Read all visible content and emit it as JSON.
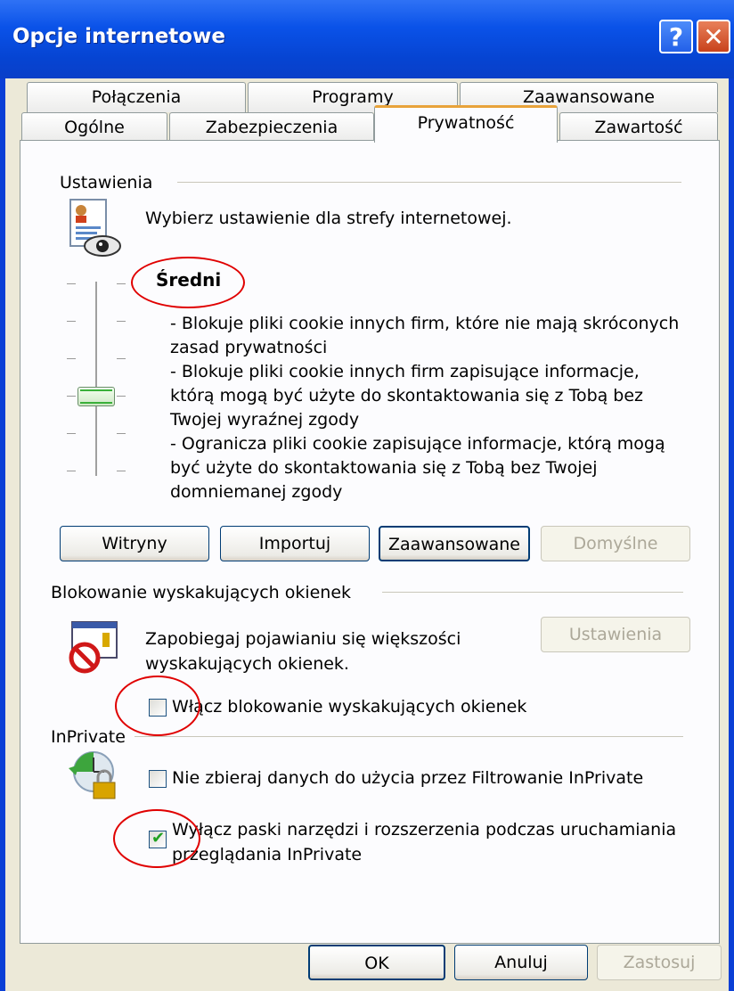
{
  "window": {
    "title": "Opcje internetowe",
    "help_icon": "?",
    "close_icon": "✕"
  },
  "tabs": {
    "row1": [
      "Połączenia",
      "Programy",
      "Zaawansowane"
    ],
    "row2": [
      "Ogólne",
      "Zabezpieczenia",
      "Prywatność",
      "Zawartość"
    ],
    "active": "Prywatność"
  },
  "settings": {
    "section_label": "Ustawienia",
    "zone_text": "Wybierz ustawienie dla strefy internetowej.",
    "level": "Średni",
    "description": [
      "- Blokuje pliki cookie innych firm, które nie mają skróconych",
      "zasad prywatności",
      "- Blokuje pliki cookie innych firm zapisujące informacje,",
      "którą mogą być użyte do skontaktowania się z Tobą bez",
      "Twojej wyraźnej zgody",
      "- Ogranicza pliki cookie zapisujące informacje, którą mogą",
      "być użyte do skontaktowania się z Tobą bez Twojej",
      "domniemanej zgody"
    ],
    "buttons": {
      "sites": "Witryny",
      "import": "Importuj",
      "advanced": "Zaawansowane",
      "default": "Domyślne"
    }
  },
  "popup": {
    "section_label": "Blokowanie wyskakujących okienek",
    "text_line1": "Zapobiegaj pojawianiu się większości",
    "text_line2": "wyskakujących okienek.",
    "settings_button": "Ustawienia",
    "checkbox_label": "Włącz blokowanie wyskakujących okienek",
    "checkbox_checked": false
  },
  "inprivate": {
    "section_label": "InPrivate",
    "checkbox1_label": "Nie zbieraj danych do użycia przez Filtrowanie InPrivate",
    "checkbox1_checked": false,
    "checkbox2_label_line1": "Wyłącz paski narzędzi i rozszerzenia podczas uruchamiania",
    "checkbox2_label_line2": "przeglądania InPrivate",
    "checkbox2_checked": true,
    "check_glyph": "✔"
  },
  "footer": {
    "ok": "OK",
    "cancel": "Anuluj",
    "apply": "Zastosuj"
  }
}
